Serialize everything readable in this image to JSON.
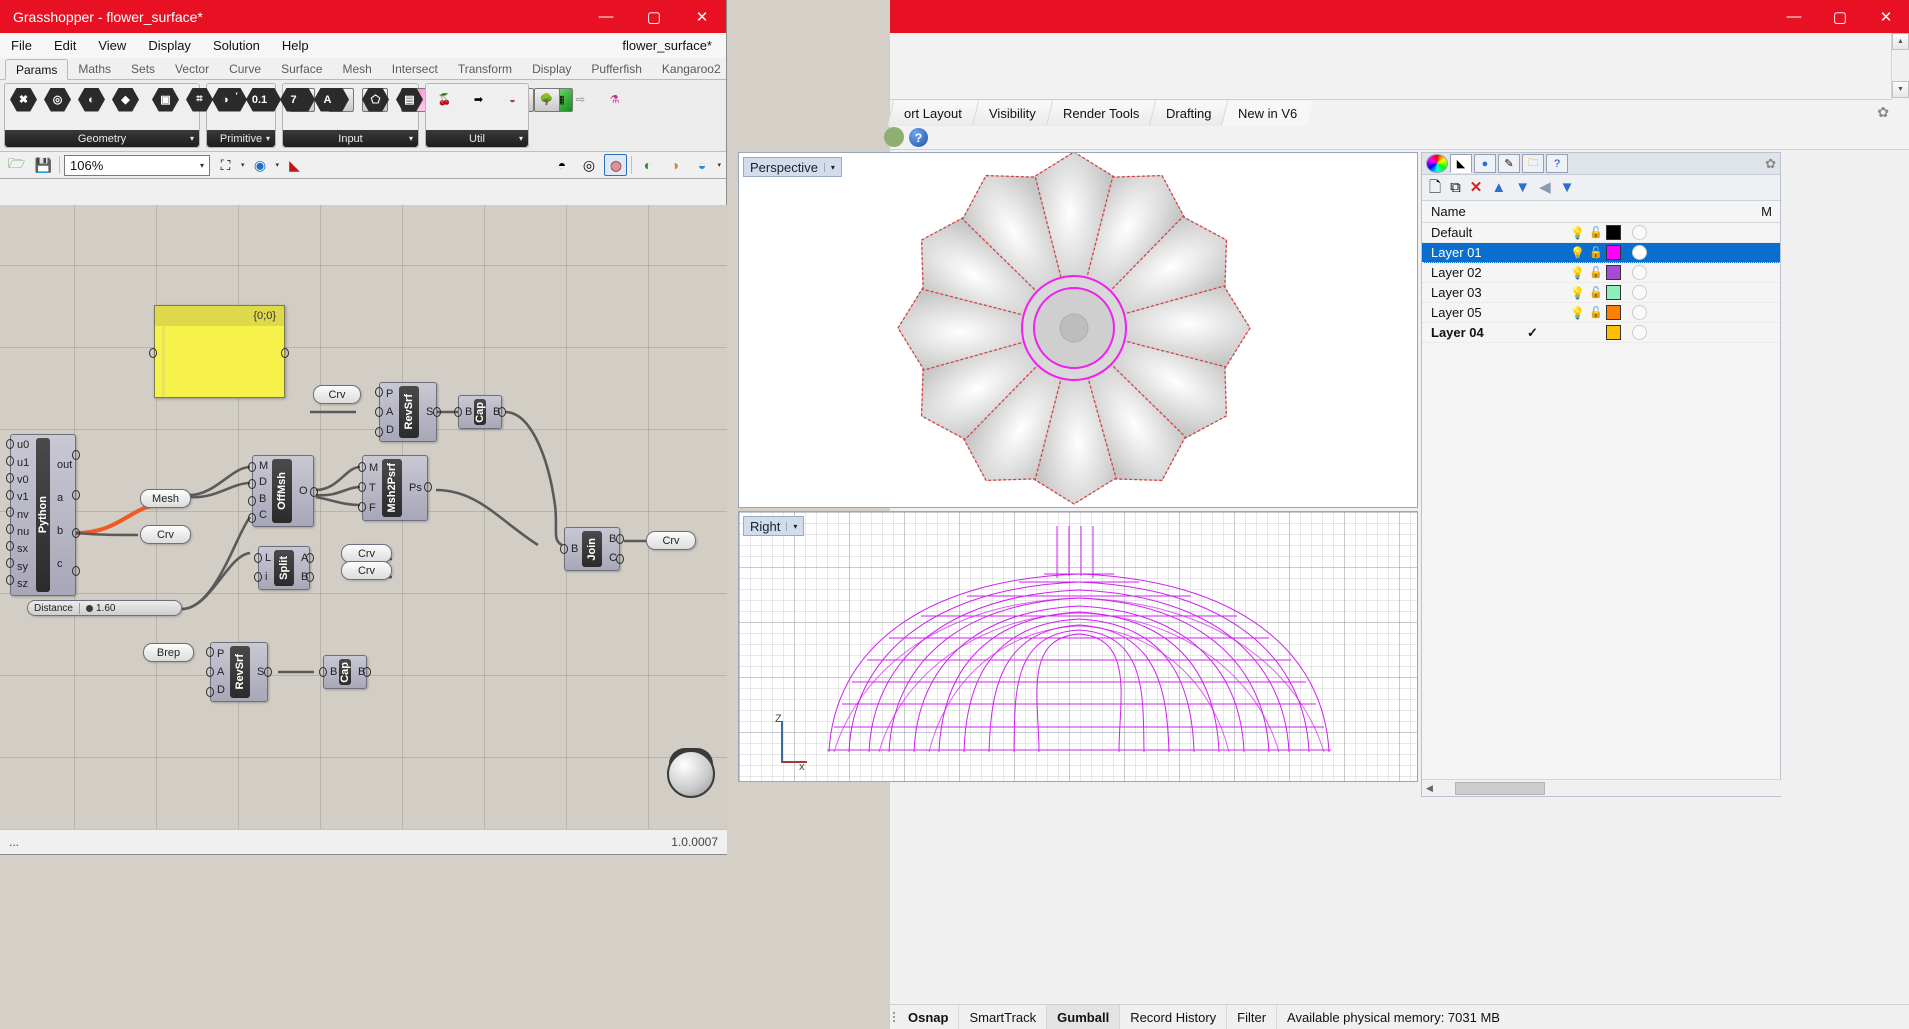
{
  "rhino": {
    "window_buttons": {
      "minimize": "—",
      "maximize": "▢",
      "close": "✕"
    },
    "tabs": [
      {
        "label": "ort Layout",
        "active": false
      },
      {
        "label": "Visibility",
        "active": false
      },
      {
        "label": "Render Tools",
        "active": false
      },
      {
        "label": "Drafting",
        "active": false
      },
      {
        "label": "New in V6",
        "active": true
      }
    ],
    "help_icon": "help-icon",
    "gear_icon": "gear-icon",
    "viewports": [
      {
        "name": "Perspective",
        "caret": "▾"
      },
      {
        "name": "Right",
        "caret": "▾"
      }
    ],
    "axis_labels": {
      "z": "Z",
      "x": "x"
    },
    "layers": {
      "tab_icons": [
        "color-wheel-icon",
        "layers-icon",
        "render-icon",
        "paint-icon",
        "folder-icon",
        "help-icon"
      ],
      "tools": [
        "new-layer-icon",
        "duplicate-layer-icon",
        "delete-layer-icon",
        "move-up-icon",
        "move-down-icon",
        "back-icon",
        "filter-icon"
      ],
      "columns": {
        "name": "Name",
        "material": "M"
      },
      "rows": [
        {
          "name": "Default",
          "color": "#000000",
          "selected": false,
          "current": false,
          "visible": true,
          "locked": false
        },
        {
          "name": "Layer 01",
          "color": "#ff00ff",
          "selected": true,
          "current": false,
          "visible": true,
          "locked": false
        },
        {
          "name": "Layer 02",
          "color": "#a64bd4",
          "selected": false,
          "current": false,
          "visible": true,
          "locked": false
        },
        {
          "name": "Layer 03",
          "color": "#8cf0bd",
          "selected": false,
          "current": false,
          "visible": true,
          "locked": false
        },
        {
          "name": "Layer 05",
          "color": "#ff8000",
          "selected": false,
          "current": false,
          "visible": true,
          "locked": false
        },
        {
          "name": "Layer 04",
          "color": "#ffbf00",
          "selected": false,
          "current": true,
          "visible": true,
          "locked": false,
          "check": "✓"
        }
      ],
      "bulb_icon": "lightbulb-icon",
      "lock_icon": "unlocked-padlock-icon"
    },
    "status_bar": [
      {
        "label": "Osnap",
        "bold": true
      },
      {
        "label": "SmartTrack",
        "bold": false
      },
      {
        "label": "Gumball",
        "bold": true,
        "highlight": true
      },
      {
        "label": "Record History",
        "bold": false
      },
      {
        "label": "Filter",
        "bold": false
      },
      {
        "label": "Available physical memory: 7031 MB",
        "bold": false
      }
    ]
  },
  "grasshopper": {
    "title": "Grasshopper - flower_surface*",
    "document_name": "flower_surface*",
    "window_buttons": {
      "minimize": "—",
      "maximize": "▢",
      "close": "✕"
    },
    "menu": [
      "File",
      "Edit",
      "View",
      "Display",
      "Solution",
      "Help"
    ],
    "tabs": [
      {
        "label": "Params",
        "active": true
      },
      {
        "label": "Maths",
        "active": false
      },
      {
        "label": "Sets",
        "active": false
      },
      {
        "label": "Vector",
        "active": false
      },
      {
        "label": "Curve",
        "active": false
      },
      {
        "label": "Surface",
        "active": false
      },
      {
        "label": "Mesh",
        "active": false
      },
      {
        "label": "Intersect",
        "active": false
      },
      {
        "label": "Transform",
        "active": false
      },
      {
        "label": "Display",
        "active": false
      },
      {
        "label": "Pufferfish",
        "active": false
      },
      {
        "label": "Kangaroo2",
        "active": false
      }
    ],
    "ribbon_groups": [
      {
        "label": "Geometry",
        "dropdown": "▾",
        "icons": [
          "geometry-x-icon",
          "brep-icon",
          "curve-param-icon",
          "surface-icon",
          "box-icon",
          "mesh-icon",
          "line-icon",
          "arc-icon",
          "point-icon",
          "plane-icon",
          "geometry-pipe-icon",
          "geometry-cache-icon"
        ]
      },
      {
        "label": "Primitive",
        "dropdown": "▾",
        "icons": [
          "boolean-icon",
          "number-icon",
          "integer-icon",
          "text-icon"
        ]
      },
      {
        "label": "Input",
        "dropdown": "▾",
        "icons": [
          "file-reader-icon",
          "button-icon",
          "graph-mapper-icon",
          "colour-swatch-icon",
          "panel-icon",
          "knob-icon",
          "value-list-icon",
          "gradient-icon"
        ]
      },
      {
        "label": "Util",
        "dropdown": "▾",
        "icons": [
          "cherry-icon",
          "jump-icon",
          "data-icon",
          "tree-icon",
          "relay-icon",
          "flask-icon"
        ]
      }
    ],
    "canvas_toolbar": {
      "open_icon": "open-file-icon",
      "save_icon": "save-file-icon",
      "zoom_value": "106%",
      "zoom_caret": "▾",
      "zoom_extents_icon": "zoom-extents-icon",
      "preview_icon": "eye-preview-icon",
      "bake_icon": "bake-icon",
      "right_icons": [
        "preview-off-icon",
        "preview-wireframe-icon",
        "preview-shaded-icon",
        "preview-meshes-icon",
        "preview-materials-icon",
        "preview-colour-icon"
      ]
    },
    "footer": {
      "status": "...",
      "version": "1.0.0007"
    },
    "nav_ball": "view-navigation-ball",
    "canvas": {
      "panel": {
        "name": "panel-0-0",
        "label": "{0;0}"
      },
      "slider": {
        "name": "distance-slider",
        "label": "Distance",
        "value": "1.60"
      },
      "nodes": [
        {
          "id": "python",
          "title": "Python",
          "inputs": [
            "u0",
            "u1",
            "v0",
            "v1",
            "nv",
            "nu",
            "sx",
            "sy",
            "sz"
          ],
          "outputs": [
            "out",
            "a",
            "b",
            "c"
          ]
        },
        {
          "id": "revsrf1",
          "title": "RevSrf",
          "inputs": [
            "P",
            "A",
            "D"
          ],
          "outputs": [
            "S"
          ]
        },
        {
          "id": "cap1",
          "title": "Cap",
          "inputs": [
            "B"
          ],
          "outputs": [
            "B"
          ]
        },
        {
          "id": "offmsh",
          "title": "OffMsh",
          "inputs": [
            "M",
            "D",
            "B",
            "C"
          ],
          "outputs": [
            "O"
          ]
        },
        {
          "id": "msh2psrf",
          "title": "Msh2Psrf",
          "inputs": [
            "M",
            "T",
            "F"
          ],
          "outputs": [
            "Ps"
          ]
        },
        {
          "id": "split",
          "title": "Split",
          "inputs": [
            "L",
            "i"
          ],
          "outputs": [
            "A",
            "B"
          ]
        },
        {
          "id": "join",
          "title": "Join",
          "inputs": [
            "B"
          ],
          "outputs": [
            "B",
            "C"
          ]
        },
        {
          "id": "revsrf2",
          "title": "RevSrf",
          "inputs": [
            "P",
            "A",
            "D"
          ],
          "outputs": [
            "S"
          ]
        },
        {
          "id": "cap2",
          "title": "Cap",
          "inputs": [
            "B"
          ],
          "outputs": [
            "B"
          ]
        }
      ],
      "pills": [
        {
          "id": "mesh-param",
          "label": "Mesh"
        },
        {
          "id": "crv-param-1",
          "label": "Crv"
        },
        {
          "id": "crv-param-2",
          "label": "Crv"
        },
        {
          "id": "crv-param-3",
          "label": "Crv"
        },
        {
          "id": "crv-param-4",
          "label": "Crv"
        },
        {
          "id": "crv-param-5",
          "label": "Crv"
        },
        {
          "id": "brep-param",
          "label": "Brep"
        }
      ]
    }
  }
}
